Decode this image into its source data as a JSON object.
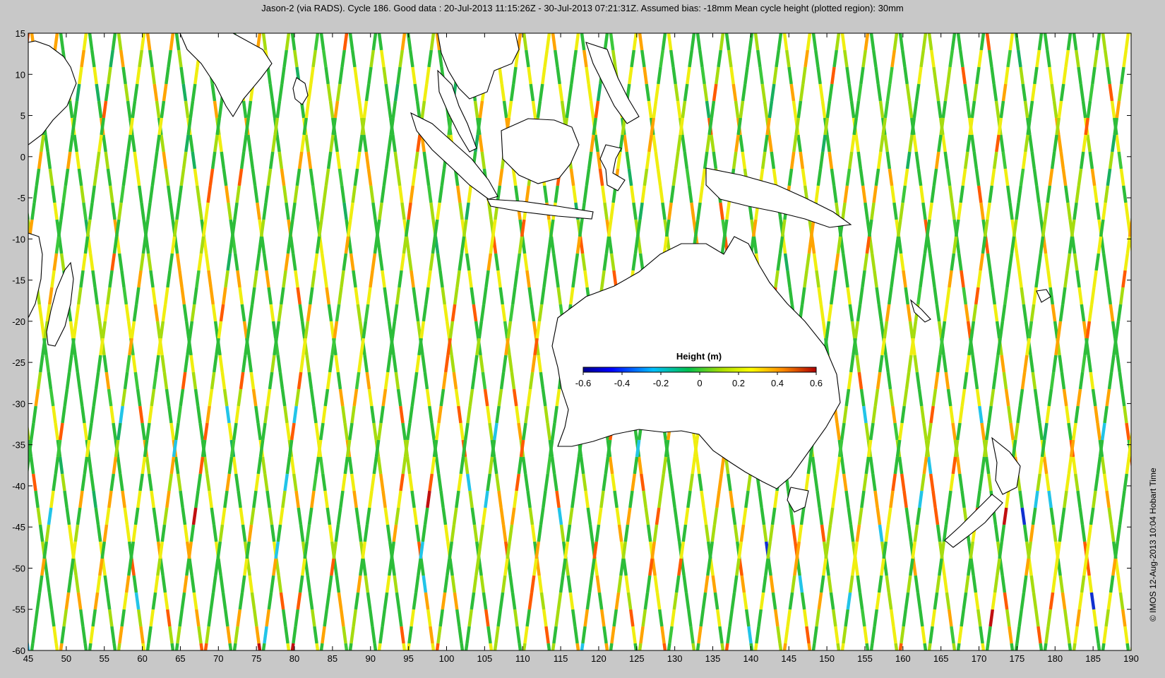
{
  "figure": {
    "title": "Jason-2 (via RADS). Cycle 186. Good data : 20-Jul-2013 11:15:26Z - 30-Jul-2013 07:21:31Z. Assumed bias: -18mm  Mean cycle height (plotted region): 30mm",
    "credit": "© IMOS 12-Aug-2013 10:04 Hobart Time"
  },
  "map": {
    "lon_range": [
      45,
      190
    ],
    "lat_range": [
      -60,
      15
    ],
    "x_ticks": [
      "45",
      "50",
      "55",
      "60",
      "65",
      "70",
      "75",
      "80",
      "85",
      "90",
      "95",
      "100",
      "105",
      "110",
      "115",
      "120",
      "125",
      "130",
      "135",
      "140",
      "145",
      "150",
      "155",
      "160",
      "165",
      "170",
      "175",
      "180",
      "185",
      "190"
    ],
    "y_ticks": [
      "15",
      "10",
      "5",
      "0",
      "-5",
      "-10",
      "-15",
      "-20",
      "-25",
      "-30",
      "-35",
      "-40",
      "-45",
      "-50",
      "-55",
      "-60"
    ],
    "ocean_color": "#ffffff",
    "land_outline_color": "#000000"
  },
  "colorbar": {
    "title": "Height (m)",
    "range": [
      -0.6,
      0.6
    ],
    "tick_labels": [
      "-0.6",
      "-0.4",
      "-0.2",
      "0",
      "0.2",
      "0.4",
      "0.6"
    ],
    "colormap": [
      "#00008f",
      "#0000ff",
      "#0080ff",
      "#00e0ff",
      "#00c050",
      "#30c030",
      "#b0e000",
      "#ffff00",
      "#ffa000",
      "#ff5000",
      "#b00000"
    ]
  }
}
